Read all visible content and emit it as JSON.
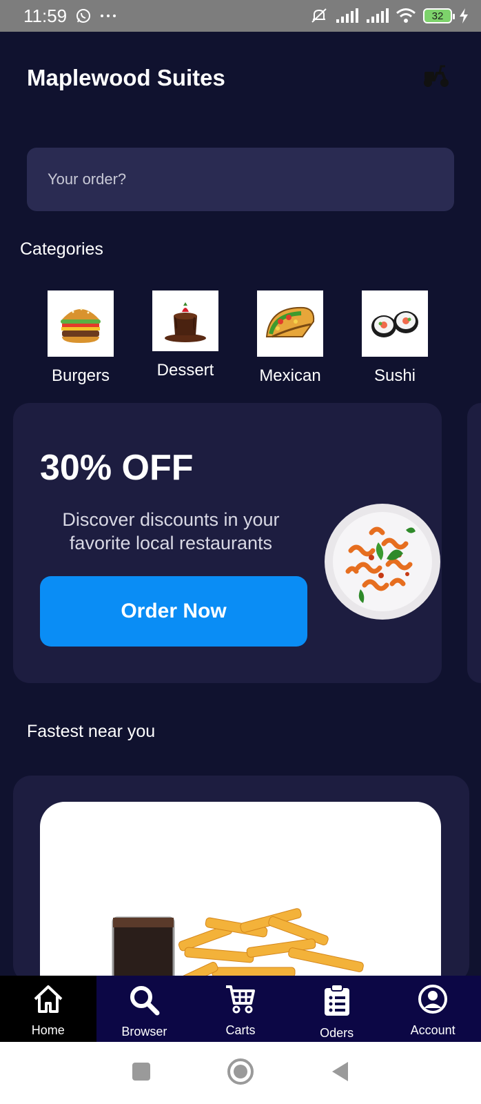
{
  "status_bar": {
    "time": "11:59",
    "battery": "32",
    "icons": [
      "whatsapp-icon",
      "more-dots-icon",
      "mute-icon",
      "signal-icon",
      "signal-icon",
      "wifi-icon",
      "battery-icon",
      "charging-icon"
    ]
  },
  "header": {
    "title": "Maplewood Suites",
    "icon": "scooter-icon"
  },
  "search": {
    "placeholder": "Your order?"
  },
  "categories": {
    "title": "Categories",
    "items": [
      {
        "label": "Burgers",
        "icon": "burger-icon"
      },
      {
        "label": "Dessert",
        "icon": "cake-icon"
      },
      {
        "label": "Mexican",
        "icon": "taco-icon"
      },
      {
        "label": "Sushi",
        "icon": "sushi-icon"
      }
    ]
  },
  "promo": {
    "headline": "30% OFF",
    "description": "Discover discounts in your favorite local restaurants",
    "button": "Order Now",
    "image": "pasta-plate-icon"
  },
  "fastest": {
    "title": "Fastest near you",
    "image": "fries-soda-icon"
  },
  "bottom_nav": {
    "items": [
      {
        "label": "Home",
        "icon": "home-icon",
        "active": true
      },
      {
        "label": "Browser",
        "icon": "search-icon",
        "active": false
      },
      {
        "label": "Carts",
        "icon": "cart-icon",
        "active": false
      },
      {
        "label": "Oders",
        "icon": "clipboard-list-icon",
        "active": false
      },
      {
        "label": "Account",
        "icon": "account-icon",
        "active": false
      }
    ]
  },
  "system_nav": [
    "square-icon",
    "circle-icon",
    "back-triangle-icon"
  ],
  "colors": {
    "background": "#10122f",
    "card": "#1d1d40",
    "search": "#2a2b52",
    "accent": "#0a8df5",
    "nav": "#0c0745"
  }
}
